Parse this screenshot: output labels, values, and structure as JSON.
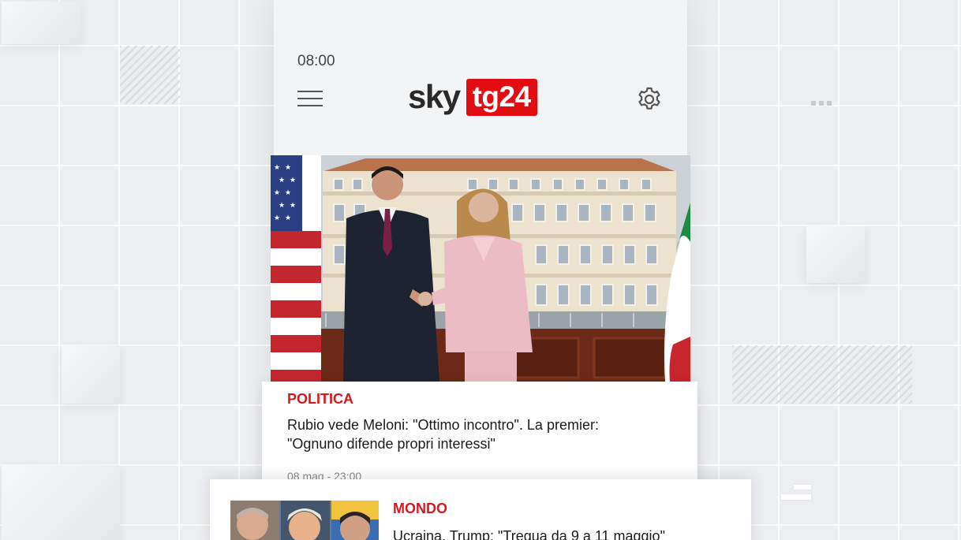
{
  "status_bar": {
    "time": "08:00"
  },
  "header": {
    "logo_sky": "sky",
    "logo_tg": "tg24",
    "menu_icon": "hamburger-menu-icon",
    "settings_icon": "gear-icon"
  },
  "articles": [
    {
      "category": "POLITICA",
      "headline_line1": "Rubio vede Meloni: \"Ottimo incontro\". La premier:",
      "headline_line2": "\"Ognuno difende propri interessi\"",
      "date": "08 mag - 23:00"
    },
    {
      "category": "MONDO",
      "headline": "Ucraina, Trump: \"Tregua da 9 a 11 maggio\""
    }
  ],
  "colors": {
    "brand_red": "#e10d13",
    "category_red": "#d21a1f",
    "background": "#eceef1"
  }
}
